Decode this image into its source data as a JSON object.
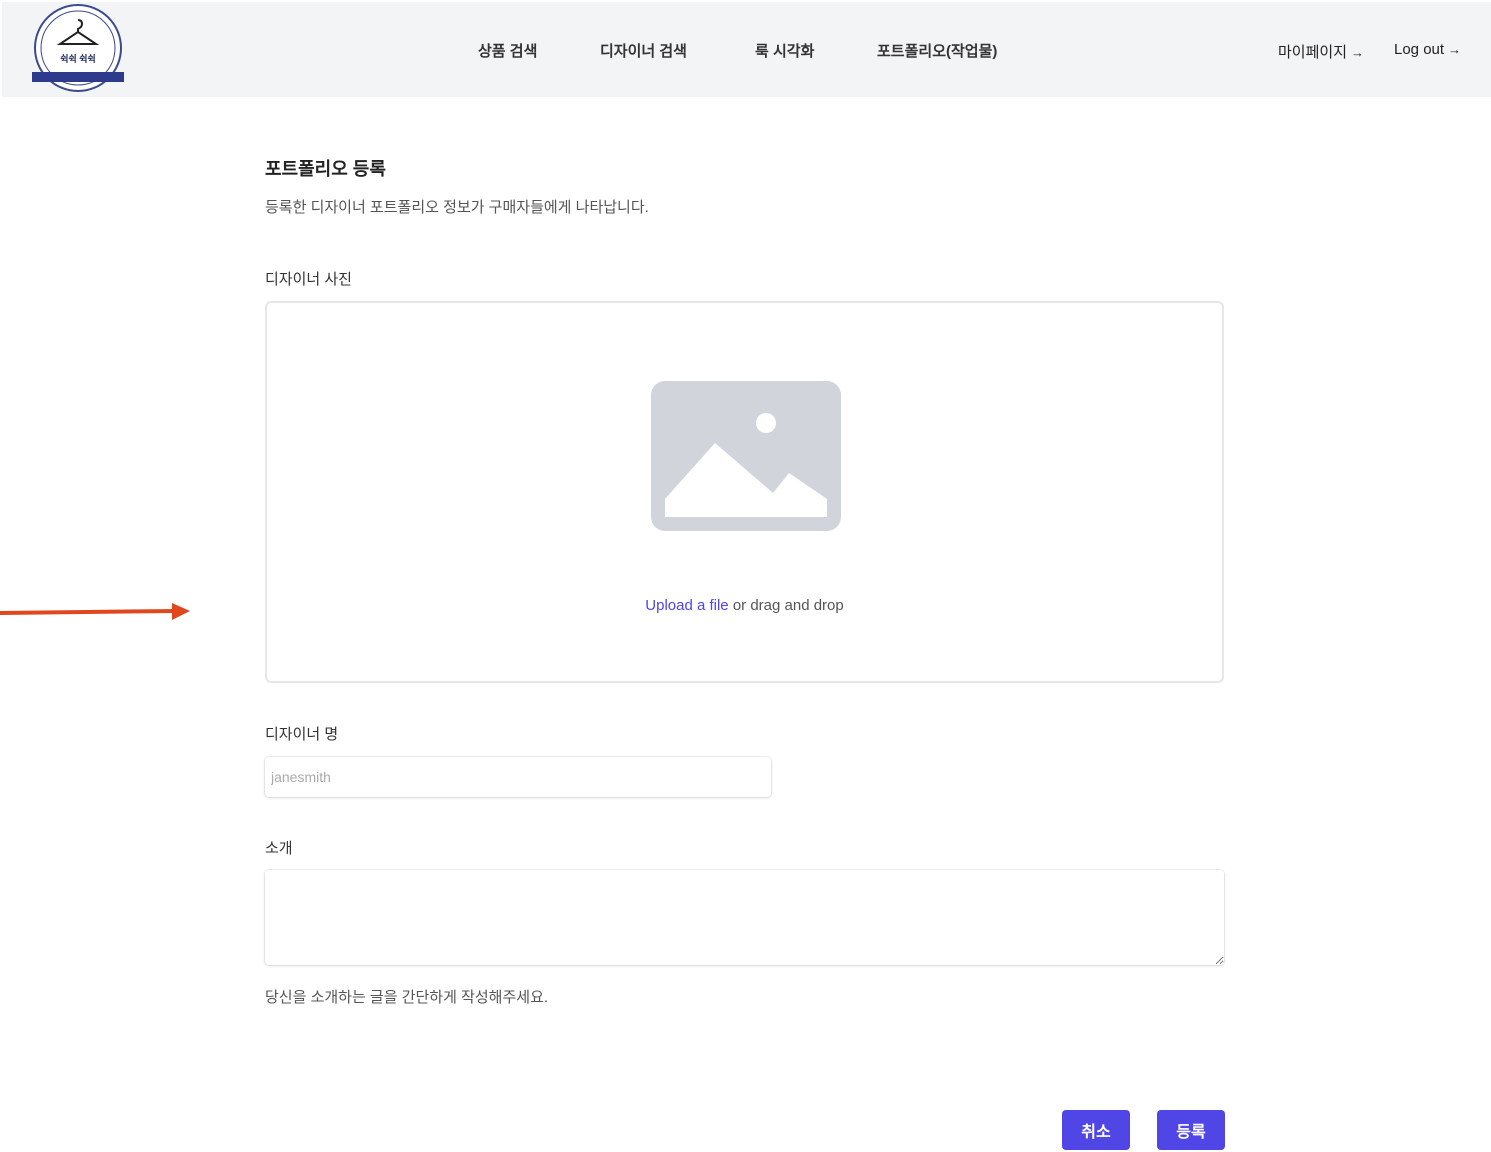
{
  "header": {
    "logo_text": "쉭쉭 쉭쉭",
    "nav": [
      {
        "label": "상품 검색"
      },
      {
        "label": "디자이너 검색"
      },
      {
        "label": "룩 시각화"
      },
      {
        "label": "포트폴리오(작업물)"
      }
    ],
    "mypage_label": "마이페이지",
    "logout_label": "Log out",
    "arrow": "→"
  },
  "form": {
    "title": "포트폴리오 등록",
    "subtitle": "등록한 디자이너 포트폴리오 정보가 구매자들에게 나타납니다.",
    "photo_label": "디자이너 사진",
    "upload_link": "Upload a file",
    "upload_rest": " or drag and drop",
    "name_label": "디자이너 명",
    "name_placeholder": "janesmith",
    "intro_label": "소개",
    "intro_hint": "당신을 소개하는 글을 간단하게 작성해주세요.",
    "cancel_label": "취소",
    "submit_label": "등록"
  },
  "colors": {
    "accent": "#4f46e5",
    "header_bg": "#f3f4f6",
    "annotation_arrow": "#e0471f"
  },
  "icons": [
    "hanger-logo-icon",
    "image-placeholder-icon",
    "arrow-right-icon",
    "annotation-arrow-icon"
  ]
}
